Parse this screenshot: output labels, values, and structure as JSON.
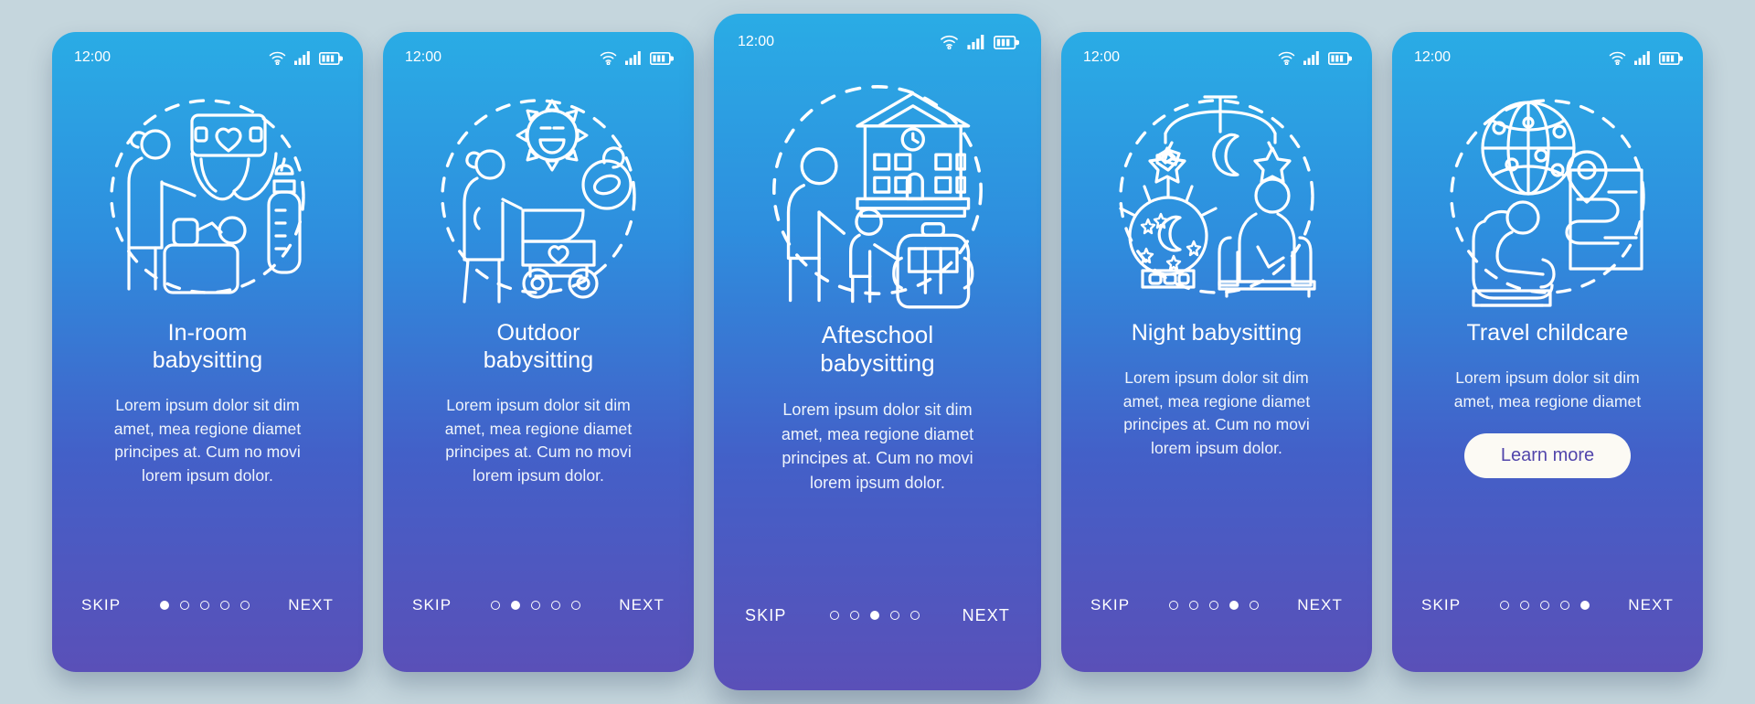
{
  "background_color": "#c5d6dd",
  "common": {
    "status_time": "12:00",
    "skip_label": "SKIP",
    "next_label": "NEXT",
    "wifi_icon": "wifi-icon",
    "signal_icon": "signal-bars-icon",
    "battery_icon": "battery-icon",
    "total_dots": 5
  },
  "screens": [
    {
      "id": "in-room-babysitting",
      "featured": false,
      "status_time": "12:00",
      "title": "In-room\nbabysitting",
      "body": "Lorem ipsum dolor sit dim\namet, mea regione diamet\nprincipes at. Cum no movi\nlorem ipsum dolor.",
      "illustration": "woman-changing-baby-diaper-bottle-icon",
      "active_dot": 1,
      "skip_label": "SKIP",
      "next_label": "NEXT",
      "cta": null
    },
    {
      "id": "outdoor-babysitting",
      "featured": false,
      "status_time": "12:00",
      "title": "Outdoor\nbabysitting",
      "body": "Lorem ipsum dolor sit dim\namet, mea regione diamet\nprincipes at. Cum no movi\nlorem ipsum dolor.",
      "illustration": "woman-stroller-sun-pacifier-icon",
      "active_dot": 2,
      "skip_label": "SKIP",
      "next_label": "NEXT",
      "cta": null
    },
    {
      "id": "afteschool-babysitting",
      "featured": true,
      "status_time": "12:00",
      "title": "Afteschool\nbabysitting",
      "body": "Lorem ipsum dolor sit dim\namet, mea regione diamet\nprincipes at. Cum no movi\nlorem ipsum dolor.",
      "illustration": "school-woman-child-backpack-icon",
      "active_dot": 3,
      "skip_label": "SKIP",
      "next_label": "NEXT",
      "cta": null
    },
    {
      "id": "night-babysitting",
      "featured": false,
      "status_time": "12:00",
      "title": "Night babysitting",
      "body": "Lorem ipsum dolor sit dim\namet, mea regione diamet\nprincipes at. Cum no movi\nlorem ipsum dolor.",
      "illustration": "baby-mobile-nightlight-armchair-icon",
      "active_dot": 4,
      "skip_label": "SKIP",
      "next_label": "NEXT",
      "cta": null
    },
    {
      "id": "travel-childcare",
      "featured": false,
      "status_time": "12:00",
      "title": "Travel childcare",
      "body": "Lorem ipsum dolor sit dim\namet, mea regione diamet",
      "illustration": "globe-carseat-map-icon",
      "active_dot": 5,
      "skip_label": "SKIP",
      "next_label": "NEXT",
      "cta": "Learn more"
    }
  ],
  "colors": {
    "gradient_top": "#2aace5",
    "gradient_bottom": "#5a50b8",
    "cta_background": "#fcfaf4",
    "cta_text": "#5246ab",
    "line_art": "#ffffff"
  }
}
